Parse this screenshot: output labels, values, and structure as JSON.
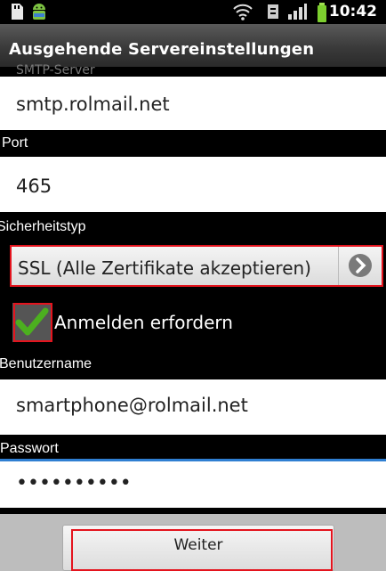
{
  "status_bar": {
    "time": "10:42",
    "icons": [
      "sd-card-icon",
      "android-icon",
      "wifi-icon",
      "sync-icon",
      "signal-icon",
      "battery-icon"
    ]
  },
  "title_bar": {
    "title": "Ausgehende Servereinstellungen",
    "partial_label": "SMTP-Server"
  },
  "form": {
    "smtp_server_value": "smtp.rolmail.net",
    "port_label": "Port",
    "port_value": "465",
    "security_label": "Sicherheitstyp",
    "security_value": "SSL (Alle Zertifikate akzeptieren)",
    "auth_label": "Anmelden erfordern",
    "auth_checked": true,
    "username_label": "Benutzername",
    "username_value": "smartphone@rolmail.net",
    "password_label": "Passwort",
    "password_value": "••••••••••"
  },
  "footer": {
    "next_label": "Weiter"
  },
  "colors": {
    "highlight_red": "#e4141e",
    "check_green": "#4caf1f",
    "focus_blue": "#2f7fd2"
  }
}
